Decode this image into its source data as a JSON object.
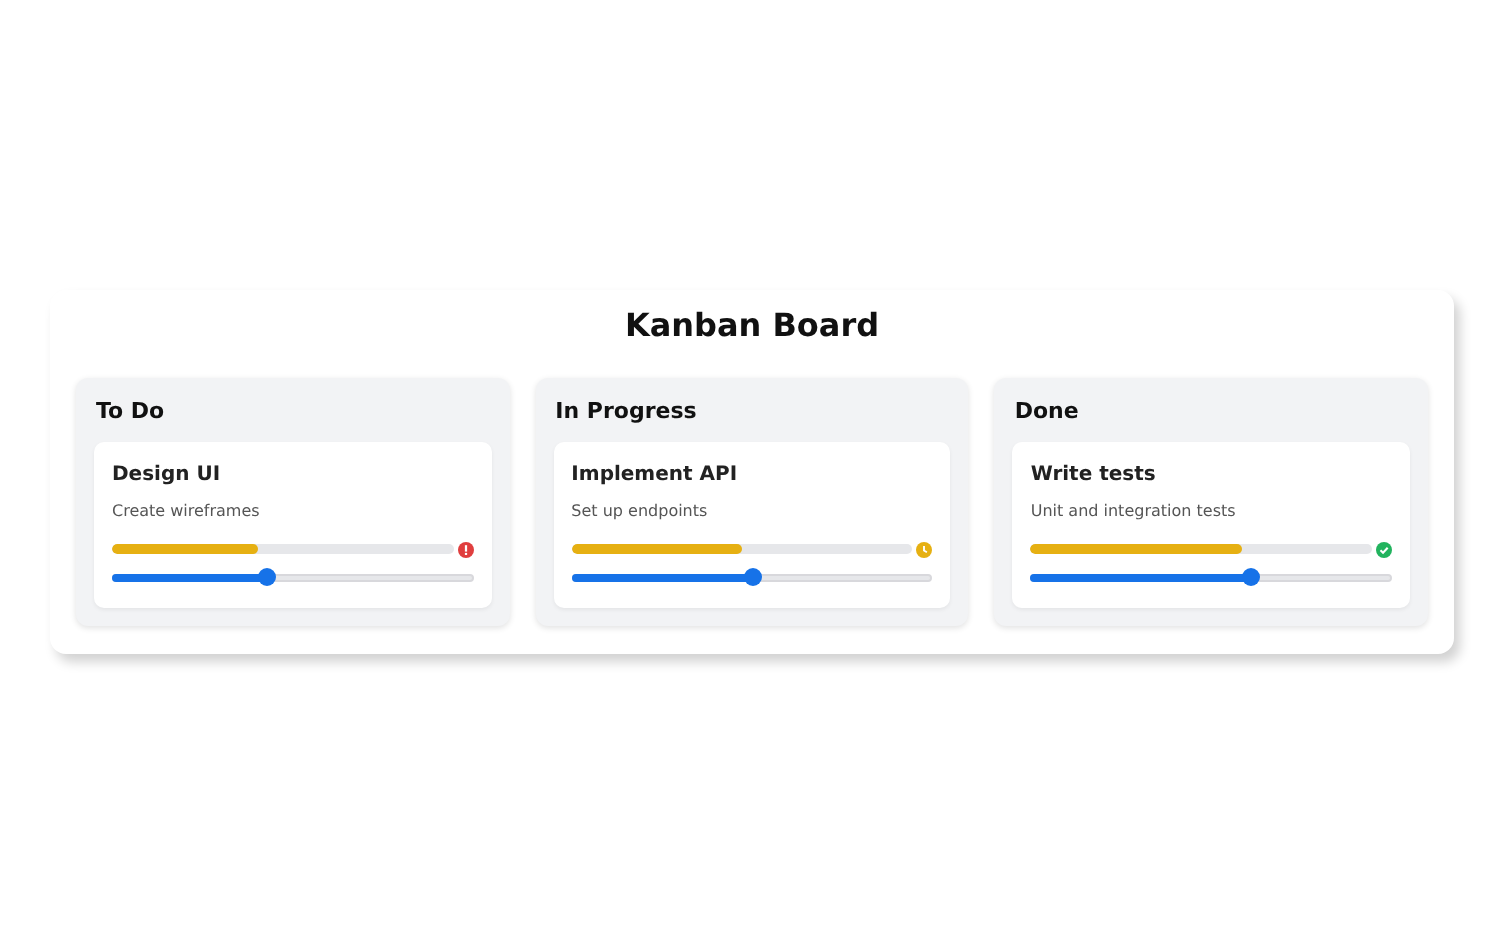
{
  "title": "Kanban Board",
  "columns": [
    {
      "name": "To Do",
      "cards": [
        {
          "title": "Design UI",
          "description": "Create wireframes",
          "progress": {
            "level": 0.43
          },
          "status_icon": {
            "kind": "alert"
          },
          "slider": {
            "level": 0.43
          }
        }
      ]
    },
    {
      "name": "In Progress",
      "cards": [
        {
          "title": "Implement API",
          "description": "Set up endpoints",
          "progress": {
            "level": 0.5
          },
          "status_icon": {
            "kind": "pending"
          },
          "slider": {
            "level": 0.5
          }
        }
      ]
    },
    {
      "name": "Done",
      "cards": [
        {
          "title": "Write tests",
          "description": "Unit and integration tests",
          "progress": {
            "level": 0.62
          },
          "status_icon": {
            "kind": "done"
          },
          "slider": {
            "level": 0.61
          }
        }
      ]
    }
  ]
}
